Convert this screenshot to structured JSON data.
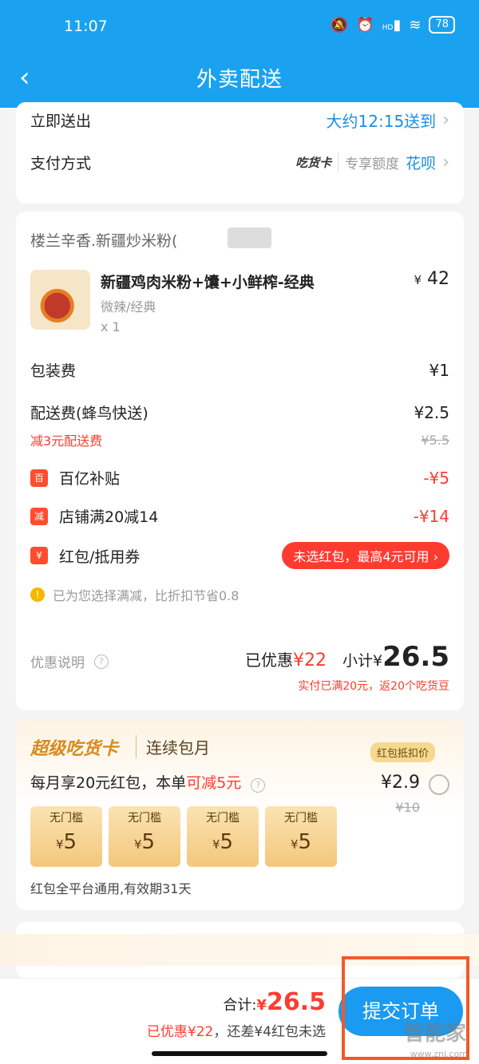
{
  "status": {
    "time": "11:07",
    "signal_tag": "HD",
    "battery": "78"
  },
  "nav": {
    "title": "外卖配送"
  },
  "delivery": {
    "label": "立即送出",
    "eta": "大约12:15送到",
    "payment_label": "支付方式",
    "payment_brand": "吃货卡",
    "payment_hint": "专享额度",
    "payment_method": "花呗"
  },
  "order": {
    "shop": "楼兰辛香.新疆炒米粉(",
    "item": {
      "name": "新疆鸡肉米粉+馕+小鲜榨-经典",
      "spec": "微辣/经典",
      "qty": "x 1",
      "price_symbol": "¥",
      "price": "42"
    },
    "packing": {
      "label": "包装费",
      "value": "¥1"
    },
    "delivery_fee": {
      "label": "配送费(蜂鸟快送)",
      "value": "¥2.5",
      "promo": "减3元配送费",
      "original": "¥5.5"
    },
    "discounts": [
      {
        "badge": "百",
        "label": "百亿补贴",
        "value": "-¥5"
      },
      {
        "badge": "减",
        "label": "店铺满20减14",
        "value": "-¥14"
      }
    ],
    "redpacket": {
      "badge": "¥",
      "label": "红包/抵用券",
      "pill": "未选红包，最高4元可用 ›"
    },
    "notice": "已为您选择满减，比折扣节省0.8",
    "promo_desc": "优惠说明",
    "saved_label": "已优惠",
    "saved_amount": "¥22",
    "subtotal_label": "小计¥",
    "subtotal": "26.5",
    "subtotal_note": "实付已满20元，返20个吃货豆"
  },
  "supercard": {
    "title": "超级吃货卡",
    "subtitle": "连续包月",
    "tag": "红包抵扣价",
    "monthly_prefix": "每月享20元红包，本单",
    "monthly_highlight": "可减5元",
    "price": "¥2.9",
    "old_price": "¥10",
    "coupons": [
      {
        "label": "无门槛",
        "symbol": "¥",
        "value": "5"
      },
      {
        "label": "无门槛",
        "symbol": "¥",
        "value": "5"
      },
      {
        "label": "无门槛",
        "symbol": "¥",
        "value": "5"
      },
      {
        "label": "无门槛",
        "symbol": "¥",
        "value": "5"
      }
    ],
    "validity": "红包全平台通用,有效期31天"
  },
  "bottom": {
    "total_label": "合计: ",
    "total_symbol": "¥",
    "total": "26.5",
    "note_red": "已优惠¥22",
    "note_grey": "，还差¥4红包未选",
    "submit": "提交订单",
    "watermark": "智能家",
    "watermark_url": "www.znj.com"
  },
  "colors": {
    "primary": "#1aa2f0",
    "accent_red": "#ff3b30",
    "gold": "#d98a1a",
    "highlight_frame": "#f05a28"
  }
}
